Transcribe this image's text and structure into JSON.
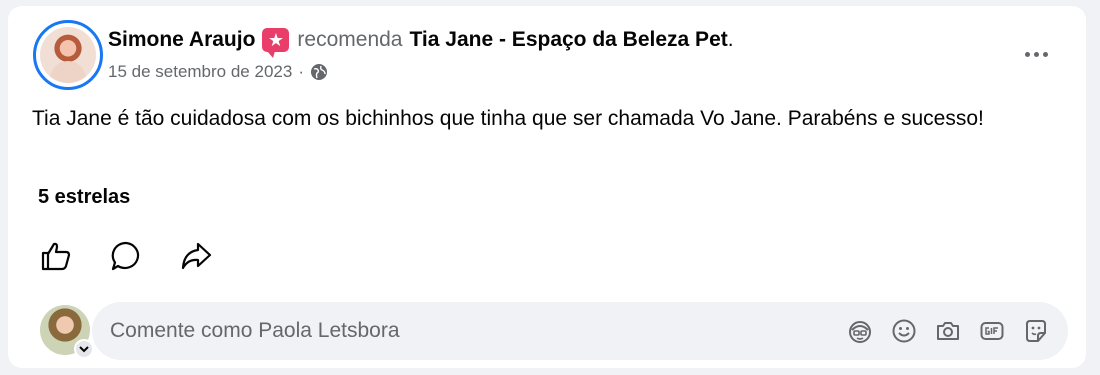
{
  "post": {
    "author": "Simone Araujo",
    "action": "recomenda",
    "page": "Tia Jane - Espaço da Beleza Pet",
    "page_suffix": ".",
    "date": "15 de setembro de 2023",
    "separator": "·",
    "privacy_icon": "globe-icon",
    "text": "Tia Jane é tão cuidadosa com os bichinhos que tinha que ser chamada Vo Jane.  Parabéns e sucesso!",
    "rating": "5 estrelas"
  },
  "actions": {
    "icons": [
      "like-icon",
      "comment-icon",
      "share-icon"
    ]
  },
  "comment": {
    "placeholder": "Comente como Paola Letsbora",
    "tools": [
      "avatar-sticker-icon",
      "emoji-icon",
      "camera-icon",
      "gif-icon",
      "sticker-icon"
    ]
  },
  "colors": {
    "accent": "#1877f2",
    "recommend_badge": "#ea3e6a",
    "secondary_text": "#65676b",
    "comment_bg": "#f0f2f5"
  }
}
